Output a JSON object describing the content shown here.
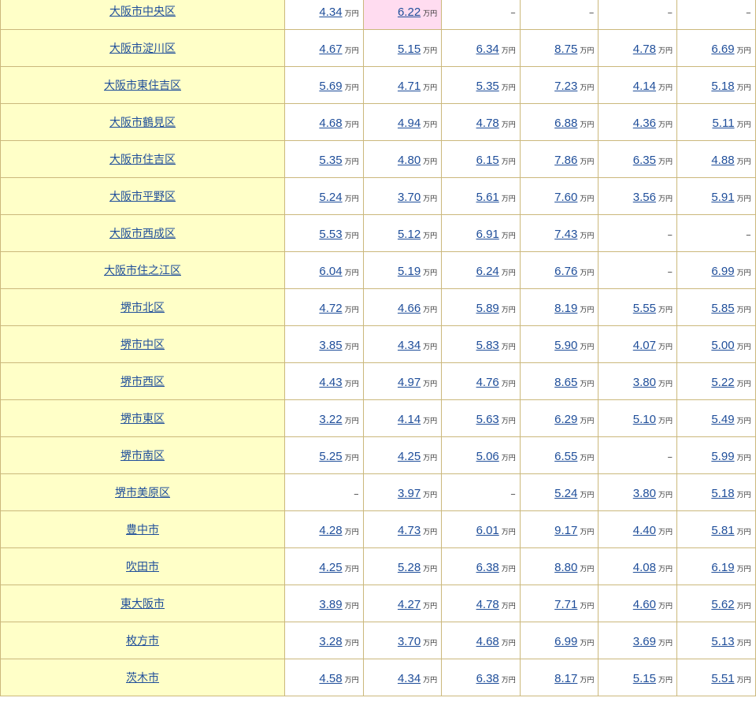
{
  "unit": "万円",
  "dash": "–",
  "rows": [
    {
      "area": "大阪市中央区",
      "prices": [
        "4.34",
        "6.22",
        null,
        null,
        null,
        null
      ],
      "highlight": 1
    },
    {
      "area": "大阪市淀川区",
      "prices": [
        "4.67",
        "5.15",
        "6.34",
        "8.75",
        "4.78",
        "6.69"
      ]
    },
    {
      "area": "大阪市東住吉区",
      "prices": [
        "5.69",
        "4.71",
        "5.35",
        "7.23",
        "4.14",
        "5.18"
      ]
    },
    {
      "area": "大阪市鶴見区",
      "prices": [
        "4.68",
        "4.94",
        "4.78",
        "6.88",
        "4.36",
        "5.11"
      ]
    },
    {
      "area": "大阪市住吉区",
      "prices": [
        "5.35",
        "4.80",
        "6.15",
        "7.86",
        "6.35",
        "4.88"
      ]
    },
    {
      "area": "大阪市平野区",
      "prices": [
        "5.24",
        "3.70",
        "5.61",
        "7.60",
        "3.56",
        "5.91"
      ]
    },
    {
      "area": "大阪市西成区",
      "prices": [
        "5.53",
        "5.12",
        "6.91",
        "7.43",
        null,
        null
      ]
    },
    {
      "area": "大阪市住之江区",
      "prices": [
        "6.04",
        "5.19",
        "6.24",
        "6.76",
        null,
        "6.99"
      ]
    },
    {
      "area": "堺市北区",
      "prices": [
        "4.72",
        "4.66",
        "5.89",
        "8.19",
        "5.55",
        "5.85"
      ]
    },
    {
      "area": "堺市中区",
      "prices": [
        "3.85",
        "4.34",
        "5.83",
        "5.90",
        "4.07",
        "5.00"
      ]
    },
    {
      "area": "堺市西区",
      "prices": [
        "4.43",
        "4.97",
        "4.76",
        "8.65",
        "3.80",
        "5.22"
      ]
    },
    {
      "area": "堺市東区",
      "prices": [
        "3.22",
        "4.14",
        "5.63",
        "6.29",
        "5.10",
        "5.49"
      ]
    },
    {
      "area": "堺市南区",
      "prices": [
        "5.25",
        "4.25",
        "5.06",
        "6.55",
        null,
        "5.99"
      ]
    },
    {
      "area": "堺市美原区",
      "prices": [
        null,
        "3.97",
        null,
        "5.24",
        "3.80",
        "5.18"
      ]
    },
    {
      "area": "豊中市",
      "prices": [
        "4.28",
        "4.73",
        "6.01",
        "9.17",
        "4.40",
        "5.81"
      ]
    },
    {
      "area": "吹田市",
      "prices": [
        "4.25",
        "5.28",
        "6.38",
        "8.80",
        "4.08",
        "6.19"
      ]
    },
    {
      "area": "東大阪市",
      "prices": [
        "3.89",
        "4.27",
        "4.78",
        "7.71",
        "4.60",
        "5.62"
      ]
    },
    {
      "area": "枚方市",
      "prices": [
        "3.28",
        "3.70",
        "4.68",
        "6.99",
        "3.69",
        "5.13"
      ]
    },
    {
      "area": "茨木市",
      "prices": [
        "4.58",
        "4.34",
        "6.38",
        "8.17",
        "5.15",
        "5.51"
      ]
    }
  ]
}
